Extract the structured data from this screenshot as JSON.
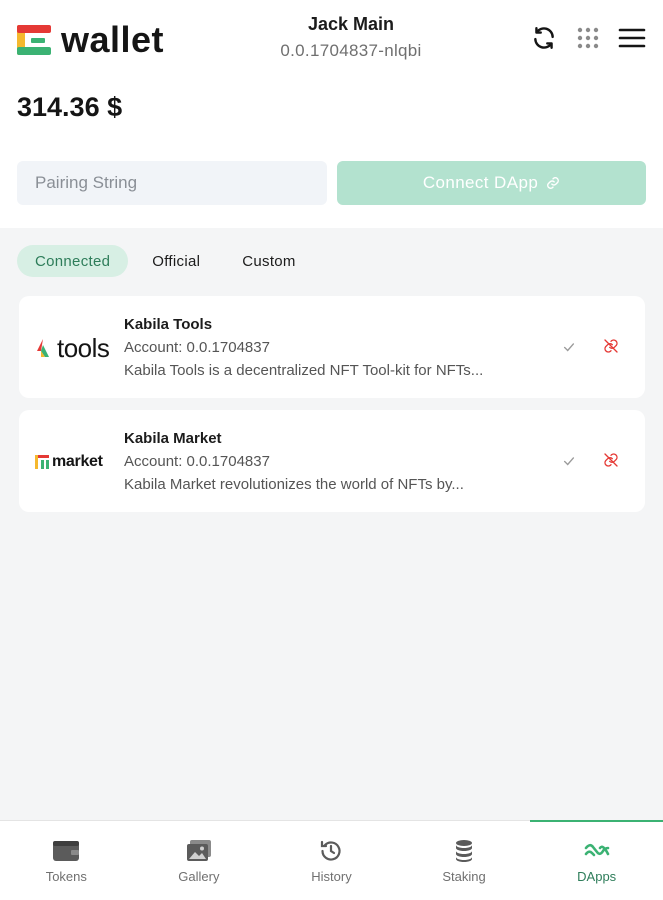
{
  "header": {
    "logo_text": "wallet",
    "account_name": "Jack Main",
    "account_id": "0.0.1704837-nlqbi",
    "icons": [
      "refresh-icon",
      "grid-icon",
      "menu-icon"
    ]
  },
  "balance": "314.36 $",
  "pairing": {
    "placeholder": "Pairing String",
    "value": "",
    "connect_label": "Connect DApp"
  },
  "tabs": [
    {
      "label": "Connected",
      "active": true
    },
    {
      "label": "Official",
      "active": false
    },
    {
      "label": "Custom",
      "active": false
    }
  ],
  "dapps": [
    {
      "logo_word": "tools",
      "title": "Kabila Tools",
      "account": "Account: 0.0.1704837",
      "description": "Kabila Tools is a decentralized NFT Tool-kit for NFTs..."
    },
    {
      "logo_word": "market",
      "title": "Kabila Market",
      "account": "Account: 0.0.1704837",
      "description": "Kabila Market revolutionizes the world of NFTs by..."
    }
  ],
  "nav": [
    {
      "label": "Tokens",
      "icon": "wallet-icon",
      "active": false
    },
    {
      "label": "Gallery",
      "icon": "gallery-icon",
      "active": false
    },
    {
      "label": "History",
      "icon": "history-icon",
      "active": false
    },
    {
      "label": "Staking",
      "icon": "coins-icon",
      "active": false
    },
    {
      "label": "DApps",
      "icon": "dapps-icon",
      "active": true
    }
  ],
  "colors": {
    "accent": "#3bb273",
    "accent_light": "#b3e2cf",
    "danger": "#e53935",
    "brand_yellow": "#f5b82e"
  }
}
